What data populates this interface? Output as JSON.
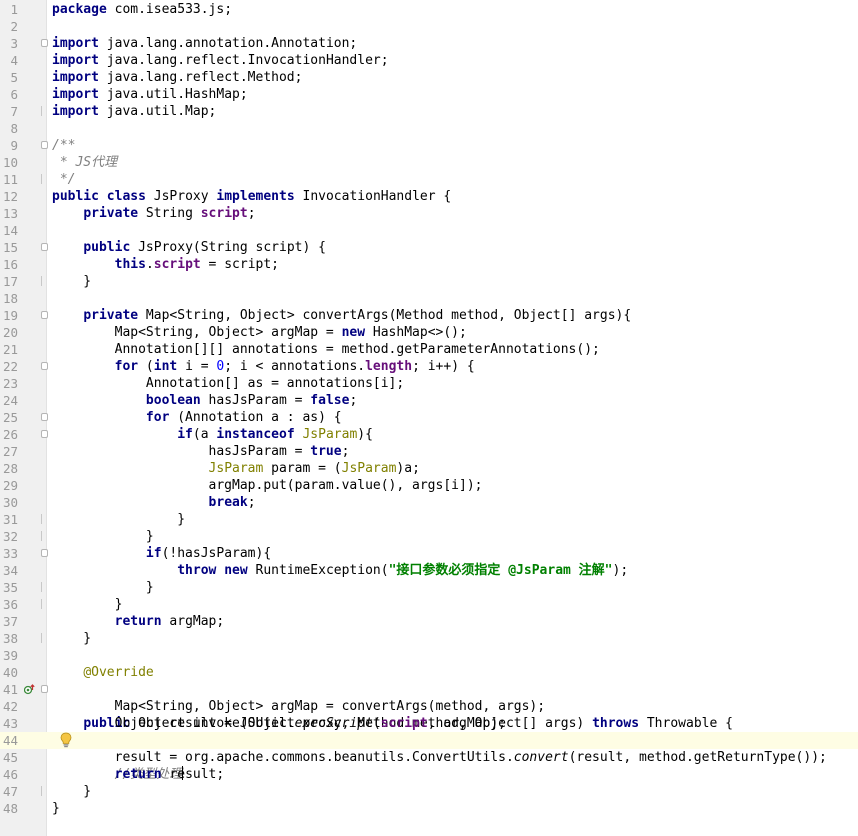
{
  "editor": {
    "language": "Java",
    "line_numbers": [
      "1",
      "2",
      "3",
      "4",
      "5",
      "6",
      "7",
      "8",
      "9",
      "10",
      "11",
      "12",
      "13",
      "14",
      "15",
      "16",
      "17",
      "18",
      "19",
      "20",
      "21",
      "22",
      "23",
      "24",
      "25",
      "26",
      "27",
      "28",
      "29",
      "30",
      "31",
      "32",
      "33",
      "34",
      "35",
      "36",
      "37",
      "38",
      "39",
      "40",
      "41",
      "42",
      "43",
      "44",
      "45",
      "46",
      "47",
      "48"
    ],
    "current_line": "44",
    "icons": {
      "line_41": "override-method-icon",
      "line_44": "lightbulb-intention-icon"
    },
    "colors": {
      "keyword": "#000080",
      "string": "#008000",
      "number": "#0000ff",
      "field": "#660e7a",
      "comment": "#808080",
      "annotation": "#808000",
      "current_line_bg": "#fefde4",
      "gutter_bg": "#f0f0f0"
    },
    "code": {
      "l1": {
        "kw": "package",
        "rest": " com.isea533.js;"
      },
      "l3": {
        "kw": "import",
        "rest": " java.lang.annotation.Annotation;"
      },
      "l4": {
        "kw": "import",
        "rest": " java.lang.reflect.InvocationHandler;"
      },
      "l5": {
        "kw": "import",
        "rest": " java.lang.reflect.Method;"
      },
      "l6": {
        "kw": "import",
        "rest": " java.util.HashMap;"
      },
      "l7": {
        "kw": "import",
        "rest": " java.util.Map;"
      },
      "l9": {
        "c": "/**"
      },
      "l10": {
        "c": " * JS代理"
      },
      "l11": {
        "c": " */"
      },
      "l12": {
        "kw1": "public",
        "kw2": "class",
        "name": " JsProxy ",
        "kw3": "implements",
        "rest": " InvocationHandler {"
      },
      "l13": {
        "indent": "    ",
        "kw": "private",
        "type": " String ",
        "fld": "script",
        "rest": ";"
      },
      "l15": {
        "indent": "    ",
        "kw": "public",
        "rest": " JsProxy(String script) {"
      },
      "l16": {
        "indent": "        ",
        "kw": "this",
        "dot": ".",
        "fld": "script",
        "rest": " = script;"
      },
      "l17": {
        "text": "    }"
      },
      "l19": {
        "indent": "    ",
        "kw": "private",
        "rest": " Map<String, Object> convertArgs(Method method, Object[] args){"
      },
      "l20": {
        "a": "        Map<String, Object> argMap = ",
        "kw": "new",
        "b": " HashMap<>();"
      },
      "l21": {
        "text": "        Annotation[][] annotations = method.getParameterAnnotations();"
      },
      "l22": {
        "indent": "        ",
        "kw1": "for",
        "a": " (",
        "kw2": "int",
        "b": " i = ",
        "num": "0",
        "c": "; i < annotations.",
        "fld": "length",
        "d": "; i++) {"
      },
      "l23": {
        "text": "            Annotation[] as = annotations[i];"
      },
      "l24": {
        "indent": "            ",
        "kw1": "boolean",
        "a": " hasJsParam = ",
        "kw2": "false",
        "b": ";"
      },
      "l25": {
        "indent": "            ",
        "kw": "for",
        "rest": " (Annotation a : as) {"
      },
      "l26": {
        "indent": "                ",
        "kw1": "if",
        "a": "(a ",
        "kw2": "instanceof",
        "sp": " ",
        "ann": "JsParam",
        "b": "){"
      },
      "l27": {
        "a": "                    hasJsParam = ",
        "kw": "true",
        "b": ";"
      },
      "l28": {
        "indent": "                    ",
        "ann1": "JsParam",
        "a": " param = (",
        "ann2": "JsParam",
        "b": ")a;"
      },
      "l29": {
        "text": "                    argMap.put(param.value(), args[i]);"
      },
      "l30": {
        "indent": "                    ",
        "kw": "break",
        "rest": ";"
      },
      "l31": {
        "text": "                }"
      },
      "l32": {
        "text": "            }"
      },
      "l33": {
        "indent": "            ",
        "kw": "if",
        "rest": "(!hasJsParam){"
      },
      "l34": {
        "indent": "                ",
        "kw1": "throw",
        "sp": " ",
        "kw2": "new",
        "a": " RuntimeException(",
        "str": "\"接口参数必须指定 @JsParam 注解\"",
        "b": ");"
      },
      "l35": {
        "text": "            }"
      },
      "l36": {
        "text": "        }"
      },
      "l37": {
        "indent": "        ",
        "kw": "return",
        "rest": " argMap;"
      },
      "l38": {
        "text": "    }"
      },
      "l40": {
        "indent": "    ",
        "ann": "@Override"
      },
      "l41": {
        "indent": "    ",
        "kw1": "public",
        "a": " Object invoke(Object proxy, Method method, Object[] args) ",
        "kw2": "throws",
        "b": " Throwable {"
      },
      "l42": {
        "text": "        Map<String, Object> argMap = convertArgs(method, args);"
      },
      "l43": {
        "a": "        Object result = JSUtil.",
        "ita": "execScript",
        "b": "(",
        "fld": "script",
        "c": ", argMap);"
      },
      "l44": {
        "indent": "        ",
        "c": "//类型处理"
      },
      "l45": {
        "a": "        result = org.apache.commons.beanutils.ConvertUtils.",
        "ita": "convert",
        "b": "(result, method.getReturnType());"
      },
      "l46": {
        "indent": "        ",
        "kw": "return",
        "rest": " result;"
      },
      "l47": {
        "text": "    }"
      },
      "l48": {
        "text": "}"
      }
    }
  }
}
